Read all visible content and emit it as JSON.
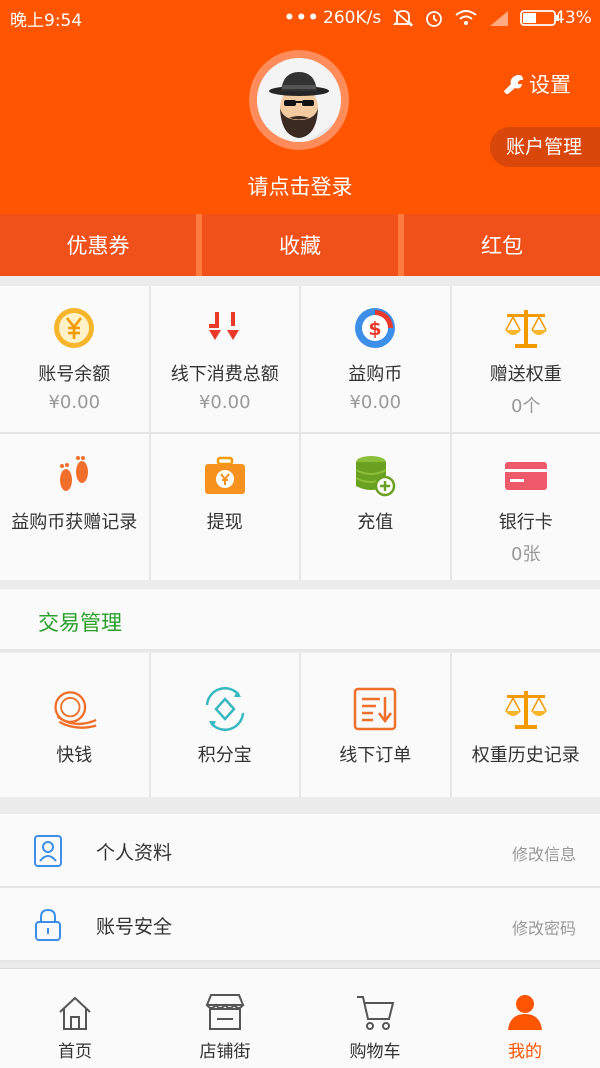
{
  "status_bar": {
    "time": "晚上9:54",
    "dots": "•••",
    "speed": "260K/s",
    "battery": "43%"
  },
  "header": {
    "login_prompt": "请点击登录",
    "settings_label": "设置",
    "account_mgmt_label": "账户管理"
  },
  "quick_tabs": [
    {
      "label": "优惠券"
    },
    {
      "label": "收藏"
    },
    {
      "label": "红包"
    }
  ],
  "assets": [
    {
      "label": "账号余额",
      "value": "¥0.00",
      "icon": "yen-coin-icon"
    },
    {
      "label": "线下消费总额",
      "value": "¥0.00",
      "icon": "double-arrow-down-icon"
    },
    {
      "label": "益购币",
      "value": "¥0.00",
      "icon": "dollar-coin-icon"
    },
    {
      "label": "赠送权重",
      "value": "0个",
      "icon": "balance-scale-icon"
    },
    {
      "label": "益购币获赠记录",
      "value": "",
      "icon": "footprints-icon"
    },
    {
      "label": "提现",
      "value": "",
      "icon": "yen-briefcase-icon"
    },
    {
      "label": "充值",
      "value": "",
      "icon": "coin-stack-plus-icon"
    },
    {
      "label": "银行卡",
      "value": "0张",
      "icon": "bank-card-icon"
    }
  ],
  "trade_section": {
    "title": "交易管理",
    "items": [
      {
        "label": "快钱",
        "icon": "coins-icon"
      },
      {
        "label": "积分宝",
        "icon": "points-diamond-icon"
      },
      {
        "label": "线下订单",
        "icon": "order-sort-icon"
      },
      {
        "label": "权重历史记录",
        "icon": "balance-scale-icon"
      }
    ]
  },
  "settings_list": [
    {
      "label": "个人资料",
      "action": "修改信息",
      "icon": "profile-card-icon"
    },
    {
      "label": "账号安全",
      "action": "修改密码",
      "icon": "lock-icon"
    }
  ],
  "tab_bar": [
    {
      "label": "首页",
      "icon": "home-icon"
    },
    {
      "label": "店铺街",
      "icon": "shop-icon"
    },
    {
      "label": "购物车",
      "icon": "cart-icon"
    },
    {
      "label": "我的",
      "icon": "user-icon",
      "active": true
    }
  ],
  "colors": {
    "brand": "#ff5400",
    "green": "#2aa02a",
    "muted": "#999999"
  }
}
